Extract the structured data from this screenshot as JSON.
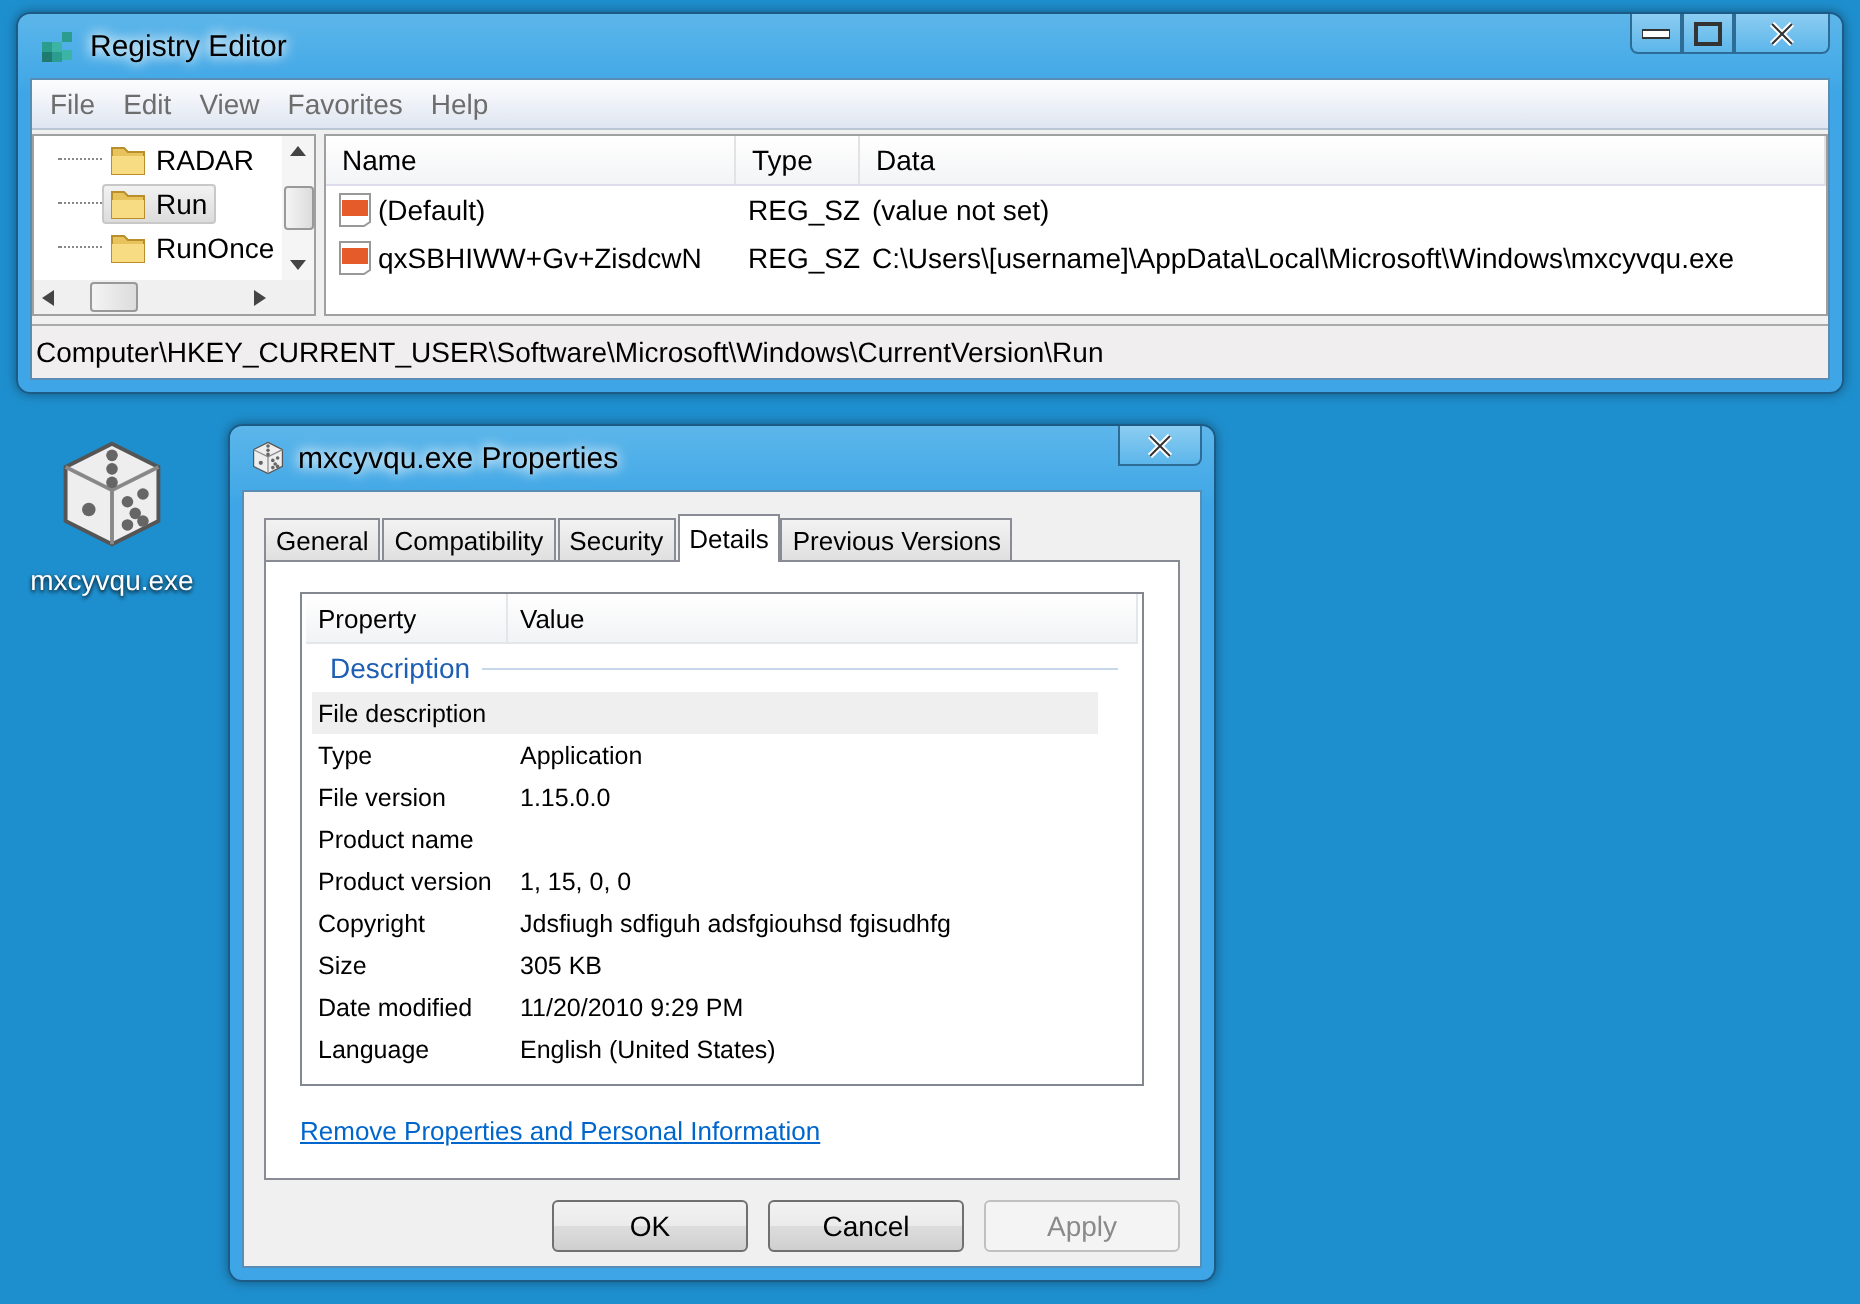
{
  "desktop_icon": {
    "label": "mxcyvqu.exe"
  },
  "registry_window": {
    "title": "Registry Editor",
    "menu": [
      "File",
      "Edit",
      "View",
      "Favorites",
      "Help"
    ],
    "tree": [
      {
        "label": "RADAR",
        "selected": false
      },
      {
        "label": "Run",
        "selected": true
      },
      {
        "label": "RunOnce",
        "selected": false
      }
    ],
    "columns": [
      "Name",
      "Type",
      "Data"
    ],
    "rows": [
      {
        "name": "(Default)",
        "type": "REG_SZ",
        "data": "(value not set)"
      },
      {
        "name": "qxSBHIWW+Gv+ZisdcwN",
        "type": "REG_SZ",
        "data": "C:\\Users\\[username]\\AppData\\Local\\Microsoft\\Windows\\mxcyvqu.exe"
      }
    ],
    "status_bar": "Computer\\HKEY_CURRENT_USER\\Software\\Microsoft\\Windows\\CurrentVersion\\Run"
  },
  "properties_window": {
    "title": "mxcyvqu.exe Properties",
    "tabs": [
      {
        "label": "General",
        "selected": false
      },
      {
        "label": "Compatibility",
        "selected": false
      },
      {
        "label": "Security",
        "selected": false
      },
      {
        "label": "Details",
        "selected": true
      },
      {
        "label": "Previous Versions",
        "selected": false
      }
    ],
    "columns": [
      "Property",
      "Value"
    ],
    "section": "Description",
    "rows": [
      {
        "property": "File description",
        "value": "",
        "selected": true
      },
      {
        "property": "Type",
        "value": "Application",
        "selected": false
      },
      {
        "property": "File version",
        "value": "1.15.0.0",
        "selected": false
      },
      {
        "property": "Product name",
        "value": "",
        "selected": false
      },
      {
        "property": "Product version",
        "value": "1, 15, 0, 0",
        "selected": false
      },
      {
        "property": "Copyright",
        "value": "Jdsfiugh sdfiguh adsfgiouhsd fgisudhfg",
        "selected": false
      },
      {
        "property": "Size",
        "value": "305 KB",
        "selected": false
      },
      {
        "property": "Date modified",
        "value": "11/20/2010 9:29 PM",
        "selected": false
      },
      {
        "property": "Language",
        "value": "English (United States)",
        "selected": false
      }
    ],
    "link": "Remove Properties and Personal Information",
    "buttons": [
      {
        "label": "OK",
        "disabled": false
      },
      {
        "label": "Cancel",
        "disabled": false
      },
      {
        "label": "Apply",
        "disabled": true
      }
    ]
  }
}
